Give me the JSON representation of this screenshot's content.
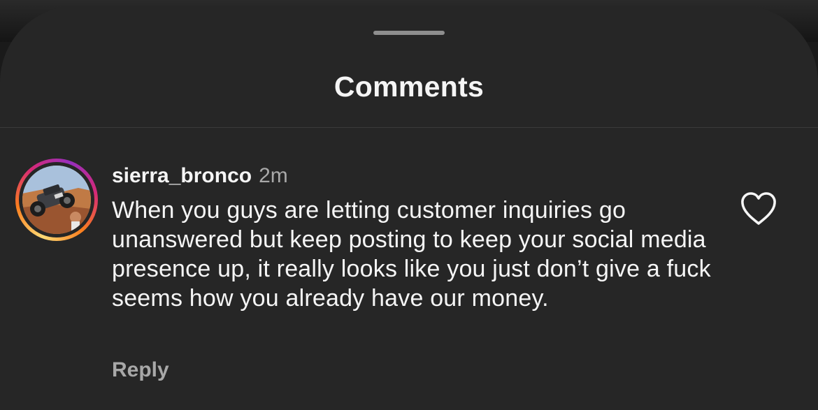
{
  "sheet": {
    "title": "Comments"
  },
  "comment": {
    "username": "sierra_bronco",
    "timestamp": "2m",
    "text": "When you guys are letting customer inquiries go unanswered but keep posting to keep your social media presence up, it really looks like you just don’t give a fuck seems how you already have our money.",
    "reply_label": "Reply",
    "avatar_icon": "user-avatar-offroad-vehicle",
    "like_icon": "heart-outline-icon"
  },
  "colors": {
    "sheet_background": "#262626",
    "primary_text": "#f5f5f5",
    "secondary_text": "#a8a8a8",
    "story_ring": [
      "#feda75",
      "#fa7e1e",
      "#d62976",
      "#962fbf"
    ]
  }
}
